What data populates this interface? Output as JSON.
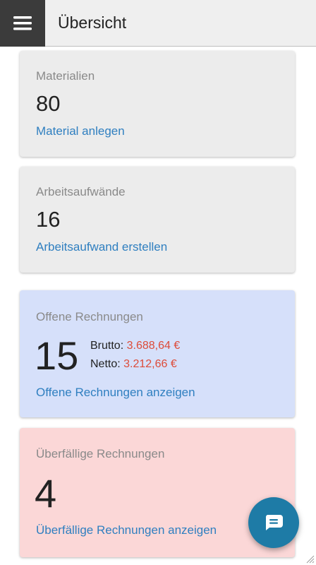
{
  "header": {
    "title": "Übersicht",
    "menu_icon": "hamburger-menu-icon"
  },
  "cards": {
    "materials": {
      "label": "Materialien",
      "count": "80",
      "link": "Material anlegen"
    },
    "labor": {
      "label": "Arbeitsaufwände",
      "count": "16",
      "link": "Arbeitsaufwand erstellen"
    },
    "open_invoices": {
      "label": "Offene Rechnungen",
      "count": "15",
      "gross_label": "Brutto:",
      "gross_value": "3.688,64 €",
      "net_label": "Netto:",
      "net_value": "3.212,66 €",
      "link": "Offene Rechnungen anzeigen"
    },
    "overdue_invoices": {
      "label": "Überfällige Rechnungen",
      "count": "4",
      "link": "Überfällige Rechnungen anzeigen"
    }
  },
  "fab": {
    "icon": "chat-bubble-icon"
  },
  "colors": {
    "link": "#2f7fc0",
    "amount": "#dd4b39",
    "header_bg": "#efefef",
    "menu_bg": "#3b3b3b",
    "card_gray": "#ececec",
    "card_blue": "#d6e0fa",
    "card_red": "#fbd7d7",
    "fab_bg": "#1e7ba6"
  }
}
